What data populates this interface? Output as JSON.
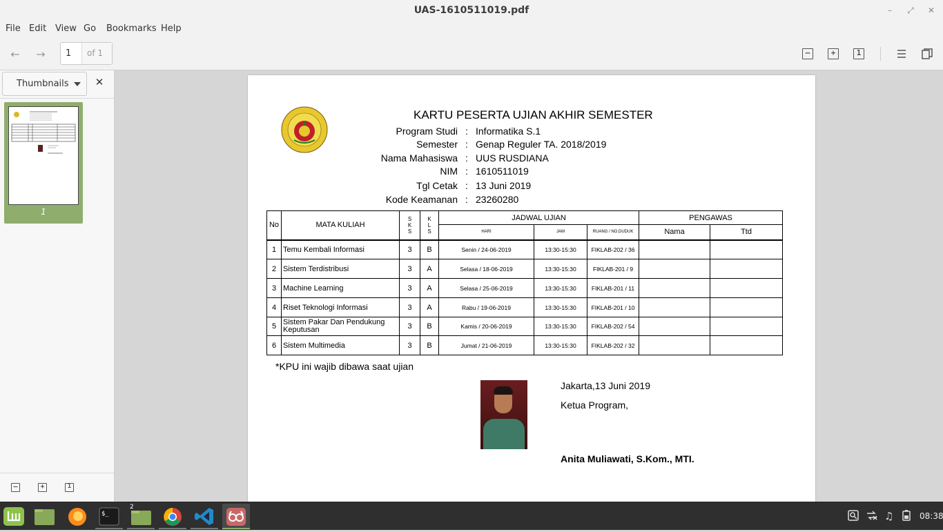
{
  "window": {
    "title": "UAS-1610511019.pdf"
  },
  "menu": [
    "File",
    "Edit",
    "View",
    "Go",
    "Bookmarks",
    "Help"
  ],
  "toolbar": {
    "page_value": "1",
    "page_of": "of 1"
  },
  "sidebar": {
    "mode_label": "Thumbnails",
    "thumb_number": "1"
  },
  "document": {
    "title": "KARTU PESERTA UJIAN AKHIR SEMESTER",
    "info": [
      {
        "label": "Program Studi",
        "value": "Informatika S.1"
      },
      {
        "label": "Semester",
        "value": "Genap Reguler TA. 2018/2019"
      },
      {
        "label": "Nama Mahasiswa",
        "value": "UUS RUSDIANA"
      },
      {
        "label": "NIM",
        "value": "1610511019"
      },
      {
        "label": "Tgl Cetak",
        "value": "13 Juni 2019"
      },
      {
        "label": "Kode Keamanan",
        "value": "23260280"
      }
    ],
    "table_headers": {
      "no": "No",
      "course": "MATA KULIAH",
      "sks": "S\nK\nS",
      "kls": "K\nL\nS",
      "schedule": "JADWAL UJIAN",
      "supervisor": "PENGAWAS",
      "day": "HARI",
      "time": "JAM",
      "room": "RUANG / NO.DUDUK",
      "name": "Nama",
      "sign": "Ttd"
    },
    "rows": [
      {
        "no": "1",
        "course": "Temu Kembali Informasi",
        "sks": "3",
        "kls": "B",
        "day": "Senin  / 24-06-2019",
        "time": "13:30-15:30",
        "room": "FIKLAB-202 / 36"
      },
      {
        "no": "2",
        "course": "Sistem Terdistribusi",
        "sks": "3",
        "kls": "A",
        "day": "Selasa / 18-06-2019",
        "time": "13:30-15:30",
        "room": "FIKLAB-201 / 9"
      },
      {
        "no": "3",
        "course": "Machine Learning",
        "sks": "3",
        "kls": "A",
        "day": "Selasa / 25-06-2019",
        "time": "13:30-15:30",
        "room": "FIKLAB-201 / 11"
      },
      {
        "no": "4",
        "course": "Riset Teknologi Informasi",
        "sks": "3",
        "kls": "A",
        "day": "Rabu  / 19-06-2019",
        "time": "13:30-15:30",
        "room": "FIKLAB-201 / 10"
      },
      {
        "no": "5",
        "course": "Sistem Pakar Dan Pendukung Keputusan",
        "sks": "3",
        "kls": "B",
        "day": "Kamis  / 20-06-2019",
        "time": "13:30-15:30",
        "room": "FIKLAB-202 / 54"
      },
      {
        "no": "6",
        "course": "Sistem Multimedia",
        "sks": "3",
        "kls": "B",
        "day": "Jumat  / 21-06-2019",
        "time": "13:30-15:30",
        "room": "FIKLAB-202 / 32"
      }
    ],
    "note": "*KPU ini wajib dibawa saat ujian",
    "place_date": "Jakarta,13 Juni 2019",
    "role": "Ketua Program,",
    "signer": "Anita Muliawati, S.Kom., MTI."
  },
  "taskbar": {
    "workspace_badge": "2",
    "clock": "08:38"
  },
  "colors": {
    "accent": "#8fad6c",
    "taskbar": "#2f2f2f"
  }
}
